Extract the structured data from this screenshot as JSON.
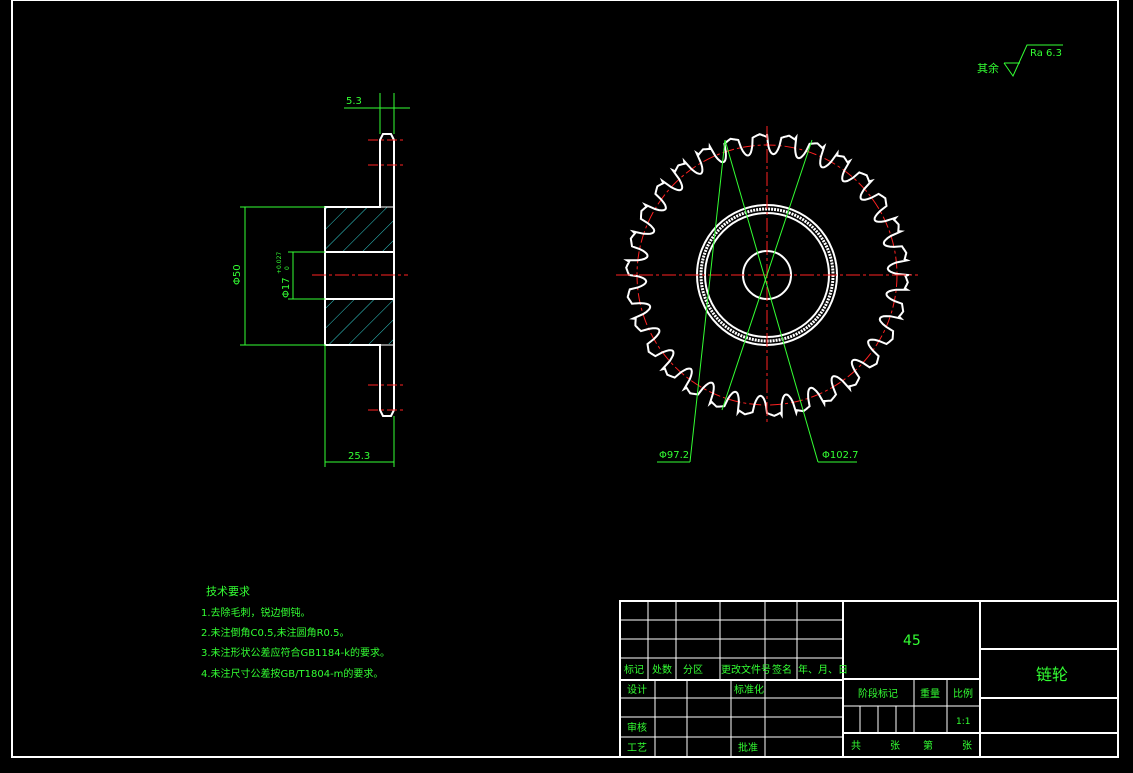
{
  "dimensions": {
    "top_width": "5.3",
    "hub_diameter": "Φ50",
    "bore_diameter": "Φ17",
    "bore_tolerance_upper": "+0.027",
    "bore_tolerance_lower": "0",
    "hub_length": "25.3",
    "root_diameter": "Φ97.2",
    "tip_diameter": "Φ102.7"
  },
  "roughness": {
    "label": "其余",
    "value": "Ra 6.3"
  },
  "tech_requirements": {
    "title": "技术要求",
    "items": [
      "1.去除毛刺，锐边倒钝。",
      "2.未注倒角C0.5,未注圆角R0.5。",
      "3.未注形状公差应符合GB1184-k的要求。",
      "4.未注尺寸公差按GB/T1804-m的要求。"
    ]
  },
  "title_block": {
    "material": "45",
    "part_name": "链轮",
    "rev_headers": [
      "标记",
      "处数",
      "分区",
      "更改文件号",
      "签名",
      "年、月、日"
    ],
    "design": "设计",
    "standardize": "标准化",
    "review": "审核",
    "process": "工艺",
    "approve": "批准",
    "stage_mark": "阶段标记",
    "weight": "重量",
    "scale": "比例",
    "scale_value": "1:1",
    "sheets_total": "共",
    "sheet_unit1": "张",
    "sheet_current": "第",
    "sheet_unit2": "张"
  },
  "colors": {
    "background": "#000000",
    "outline": "#ffffff",
    "dimension": "#33ff33",
    "centerline": "#ff2222",
    "hatch": "#33cccc"
  },
  "sprocket": {
    "teeth": 30
  }
}
